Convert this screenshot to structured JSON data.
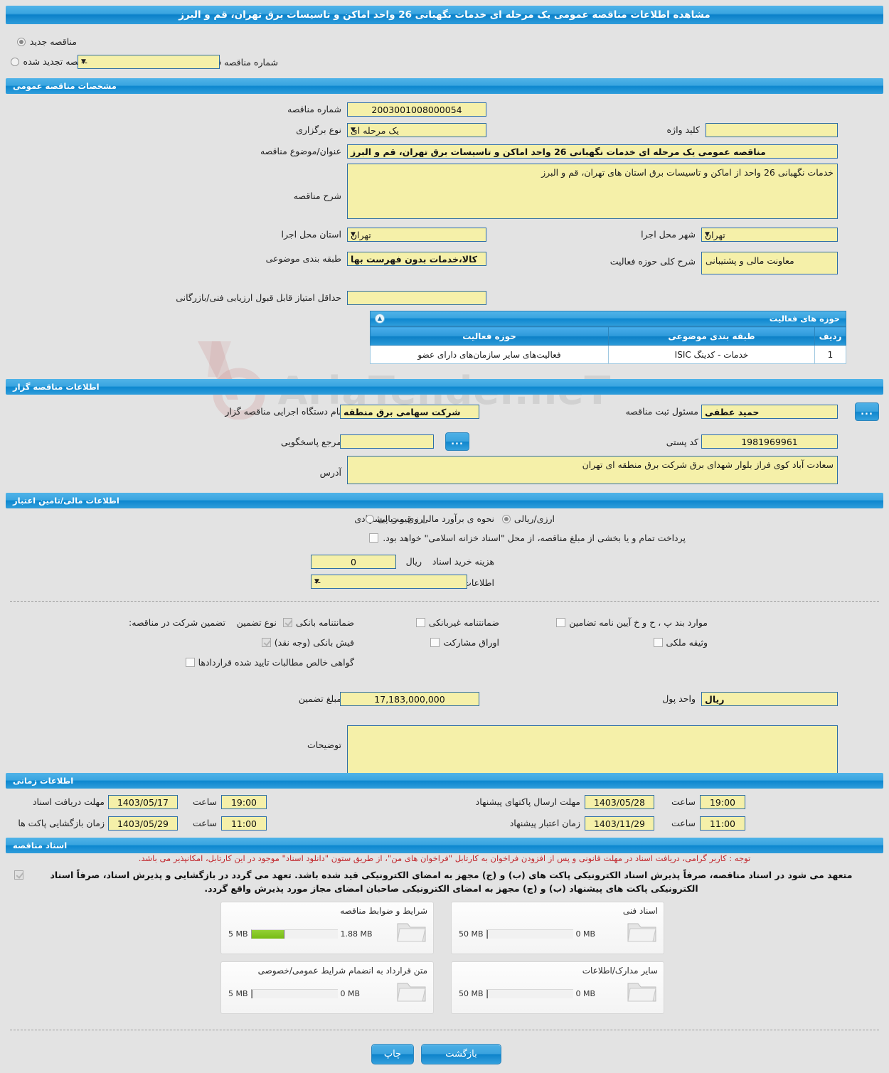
{
  "header": {
    "title": "مشاهده اطلاعات مناقصه عمومی یک مرحله ای خدمات نگهبانی 26 واحد اماکن و تاسیسات برق تهران، قم و البرز"
  },
  "tender_type": {
    "new_label": "مناقصه جدید",
    "renewed_label": "مناقصه تجدید شده",
    "selected": "new",
    "previous_number_label": "شماره مناقصه قبلی",
    "previous_number_value": "--"
  },
  "general": {
    "section_title": "مشخصات مناقصه عمومی",
    "tender_number_label": "شماره مناقصه",
    "tender_number_value": "2003001008000054",
    "holding_type_label": "نوع برگزاری",
    "holding_type_value": "یک مرحله ای",
    "keyword_label": "کلید واژه",
    "keyword_value": "",
    "subject_label": "عنوان/موضوع مناقصه",
    "subject_value": "مناقصه عمومی یک مرحله ای خدمات نگهبانی 26 واحد اماکن و تاسیسات برق تهران، قم و البرز",
    "description_label": "شرح مناقصه",
    "description_value": "خدمات نگهبانی 26 واحد از اماکن و تاسیسات برق استان های تهران، قم و البرز",
    "province_label": "استان محل اجرا",
    "province_value": "تهران",
    "city_label": "شهر محل اجرا",
    "city_value": "تهران",
    "category_label": "طبقه بندی موضوعی",
    "category_value": "کالا،خدمات بدون فهرست بها",
    "activity_scope_label": "شرح کلی حوزه فعالیت",
    "activity_scope_value": "معاونت مالی و پشتیبانی",
    "min_score_label": "حداقل امتیاز قابل قبول ارزیابی فنی/بازرگانی",
    "min_score_value": ""
  },
  "activity_table": {
    "section_title": "حوزه های فعالیت",
    "columns": [
      "ردیف",
      "طبقه بندی موضوعی",
      "حوزه فعالیت"
    ],
    "rows": [
      {
        "index": "1",
        "category": "خدمات - کدینگ ISIC",
        "scope": "فعالیت‌های سایر سازمان‌های دارای عضو"
      }
    ]
  },
  "organizer": {
    "section_title": "اطلاعات مناقصه گزار",
    "agency_label": "نام دستگاه اجرایی مناقصه گزار",
    "agency_value": "شرکت سهامی برق منطقه",
    "registrar_label": "مسئول ثبت مناقصه",
    "registrar_value": "حمید عطفی",
    "contact_label": "مرجع پاسخگویی",
    "contact_value": "",
    "postal_code_label": "کد پستی",
    "postal_code_value": "1981969961",
    "address_label": "آدرس",
    "address_value": "سعادت آباد کوی فراز بلوار شهدای برق شرکت برق منطقه ای تهران",
    "dots_label": "..."
  },
  "finance": {
    "section_title": "اطلاعات مالی/تامین اعتبار",
    "estimate_label": "نحوه ی برآورد مالی و قیمت پیشنهادی",
    "option_rial_label": "ارزی/ریالی",
    "option_currency_rial_label": "ارزی و ریالی",
    "selected_option": "rial",
    "treasury_note": "پرداخت تمام و یا بخشی از مبلغ مناقصه، از محل \"اسناد خزانه اسلامی\" خواهد بود.",
    "treasury_checked": false,
    "doc_cost_label": "هزینه خرید اسناد",
    "doc_cost_value": "0",
    "doc_cost_unit": "ریال",
    "account_info_label": "اطلاعات حساب جهت واریز هزینه خرید اسناد",
    "account_info_value": "--"
  },
  "guarantee": {
    "participation_label": "تضمین شرکت در مناقصه:",
    "type_label": "نوع تضمین",
    "options": [
      {
        "label": "ضمانتنامه بانکی",
        "checked": true
      },
      {
        "label": "ضمانتنامه غیربانکی",
        "checked": false
      },
      {
        "label": "موارد بند پ ، ح و خ آیین نامه تضامین",
        "checked": false
      },
      {
        "label": "فیش بانکی (وجه نقد)",
        "checked": true
      },
      {
        "label": "اوراق مشارکت",
        "checked": false
      },
      {
        "label": "وثیقه ملکی",
        "checked": false
      },
      {
        "label": "گواهی خالص مطالبات تایید شده قراردادها",
        "checked": false
      }
    ],
    "amount_label": "مبلغ تضمین",
    "amount_value": "17,183,000,000",
    "currency_unit_label": "واحد پول",
    "currency_unit_value": "ریال",
    "notes_label": "توضیحات",
    "notes_value": ""
  },
  "timing": {
    "section_title": "اطلاعات زمانی",
    "doc_receive_label": "مهلت دریافت اسناد",
    "doc_receive_date": "1403/05/17",
    "doc_receive_hour_label": "ساعت",
    "doc_receive_hour": "19:00",
    "envelope_open_label": "زمان بازگشایی پاکت ها",
    "envelope_open_date": "1403/05/29",
    "envelope_open_hour_label": "ساعت",
    "envelope_open_hour": "11:00",
    "proposal_send_label": "مهلت ارسال پاکتهای پیشنهاد",
    "proposal_send_date": "1403/05/28",
    "proposal_send_hour_label": "ساعت",
    "proposal_send_hour": "19:00",
    "proposal_validity_label": "زمان اعتبار پیشنهاد",
    "proposal_validity_date": "1403/11/29",
    "proposal_validity_hour_label": "ساعت",
    "proposal_validity_hour": "11:00"
  },
  "documents": {
    "section_title": "اسناد مناقصه",
    "red_notice": "توجه : کاربر گرامی، دریافت اسناد در مهلت قانونی و پس از افزودن فراخوان به کارتابل \"فراخوان های من\"، از طریق ستون \"دانلود اسناد\" موجود در این کارتابل، امکانپذیر می باشد.",
    "commit_notice": "متعهد می شود در اسناد مناقصه، صرفاً پذیرش اسناد الکترونیکی پاکت های (ب) و (ج) مجهز به امضای الکترونیکی قید شده باشد. تعهد می گردد در بازگشایی و پذیرش اسناد، صرفاً اسناد الکترونیکی پاکت های پیشنهاد (ب) و (ج) مجهز به امضای الکترونیکی صاحبان امضای مجاز مورد پذیرش واقع گردد.",
    "commit_checked": true,
    "files": [
      {
        "name": "شرایط و ضوابط مناقصه",
        "size": "1.88 MB",
        "max": "5 MB",
        "percent": 38
      },
      {
        "name": "اسناد فنی",
        "size": "0 MB",
        "max": "50 MB",
        "percent": 0
      },
      {
        "name": "متن قرارداد به انضمام شرایط عمومی/خصوصی",
        "size": "0 MB",
        "max": "5 MB",
        "percent": 0
      },
      {
        "name": "سایر مدارک/اطلاعات",
        "size": "0 MB",
        "max": "50 MB",
        "percent": 0
      }
    ]
  },
  "footer": {
    "back_label": "بازگشت",
    "print_label": "چاپ"
  },
  "watermark": {
    "text": "AriaTender.neT"
  }
}
